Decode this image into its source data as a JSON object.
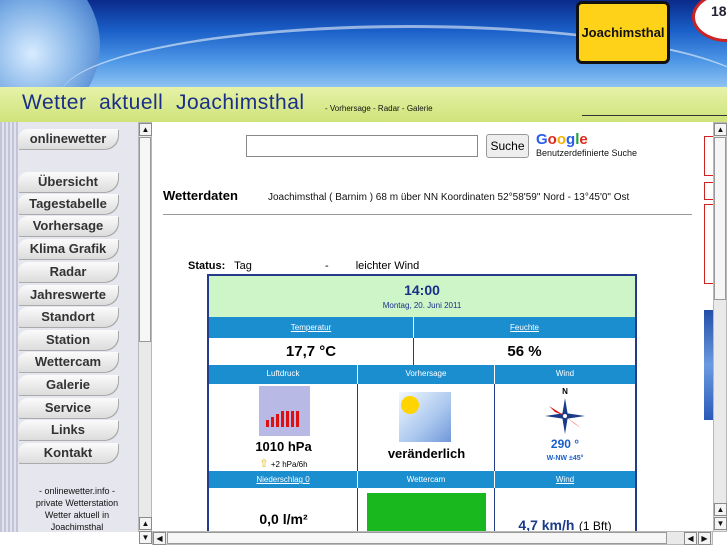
{
  "header": {
    "town_sign": "Joachimsthal",
    "speed_sign": "18"
  },
  "title_bar": {
    "site_title": "Wetter  aktuell  Joachimsthal",
    "links": "- Vorhersage -  Radar -  Galerie"
  },
  "sidebar": {
    "items": [
      {
        "label": "onlinewetter"
      },
      {
        "label": "Übersicht"
      },
      {
        "label": "Tagestabelle"
      },
      {
        "label": "Vorhersage"
      },
      {
        "label": "Klima Grafik"
      },
      {
        "label": "Radar"
      },
      {
        "label": "Jahreswerte"
      },
      {
        "label": "Standort"
      },
      {
        "label": "Station"
      },
      {
        "label": "Wettercam"
      },
      {
        "label": "Galerie"
      },
      {
        "label": "Service"
      },
      {
        "label": "Links"
      },
      {
        "label": "Kontakt"
      }
    ],
    "footer_lines": [
      "- onlinewetter.info -",
      "private Wetterstation",
      "Wetter aktuell in",
      "Joachimsthal"
    ]
  },
  "search": {
    "button": "Suche",
    "google": "Google",
    "google_sub": "Benutzerdefinierte Suche",
    "value": ""
  },
  "weather": {
    "section_title": "Wetterdaten",
    "location": "Joachimsthal ( Barnim ) 68 m über NN Koordinaten 52°58'59\" Nord - 13°45'0\" Ost",
    "status_label": "Status:",
    "status_day": "Tag",
    "status_dash": "-",
    "status_wind": "leichter Wind",
    "time": "14:00",
    "date": "Montag, 20. Juni 2011",
    "temp_header": "Temperatur",
    "temp_value": "17,7 °C",
    "hum_header": "Feuchte",
    "hum_value": "56 %",
    "pressure_header": "Luftdruck",
    "pressure_value": "1010 hPa",
    "pressure_trend": "+2 hPa/6h",
    "forecast_header": "Vorhersage",
    "forecast_value": "veränderlich",
    "wind_header": "Wind",
    "wind_deg": "290 °",
    "wind_dir": "W-NW ±45°",
    "compass_n": "N",
    "rain_header": "Niederschlag 0",
    "rain_value": "0,0 l/m²",
    "cam_header": "Wettercam",
    "wind2_header": "Wind",
    "wind_speed": "4,7 km/h",
    "wind_bft": "(1 Bft)"
  },
  "colors": {
    "table_border": "#243b8a",
    "header_blue": "#1b8ed0",
    "time_bg": "#cdf5c8",
    "cam_green": "#19b81e",
    "pressure_bars": "#e01010"
  }
}
